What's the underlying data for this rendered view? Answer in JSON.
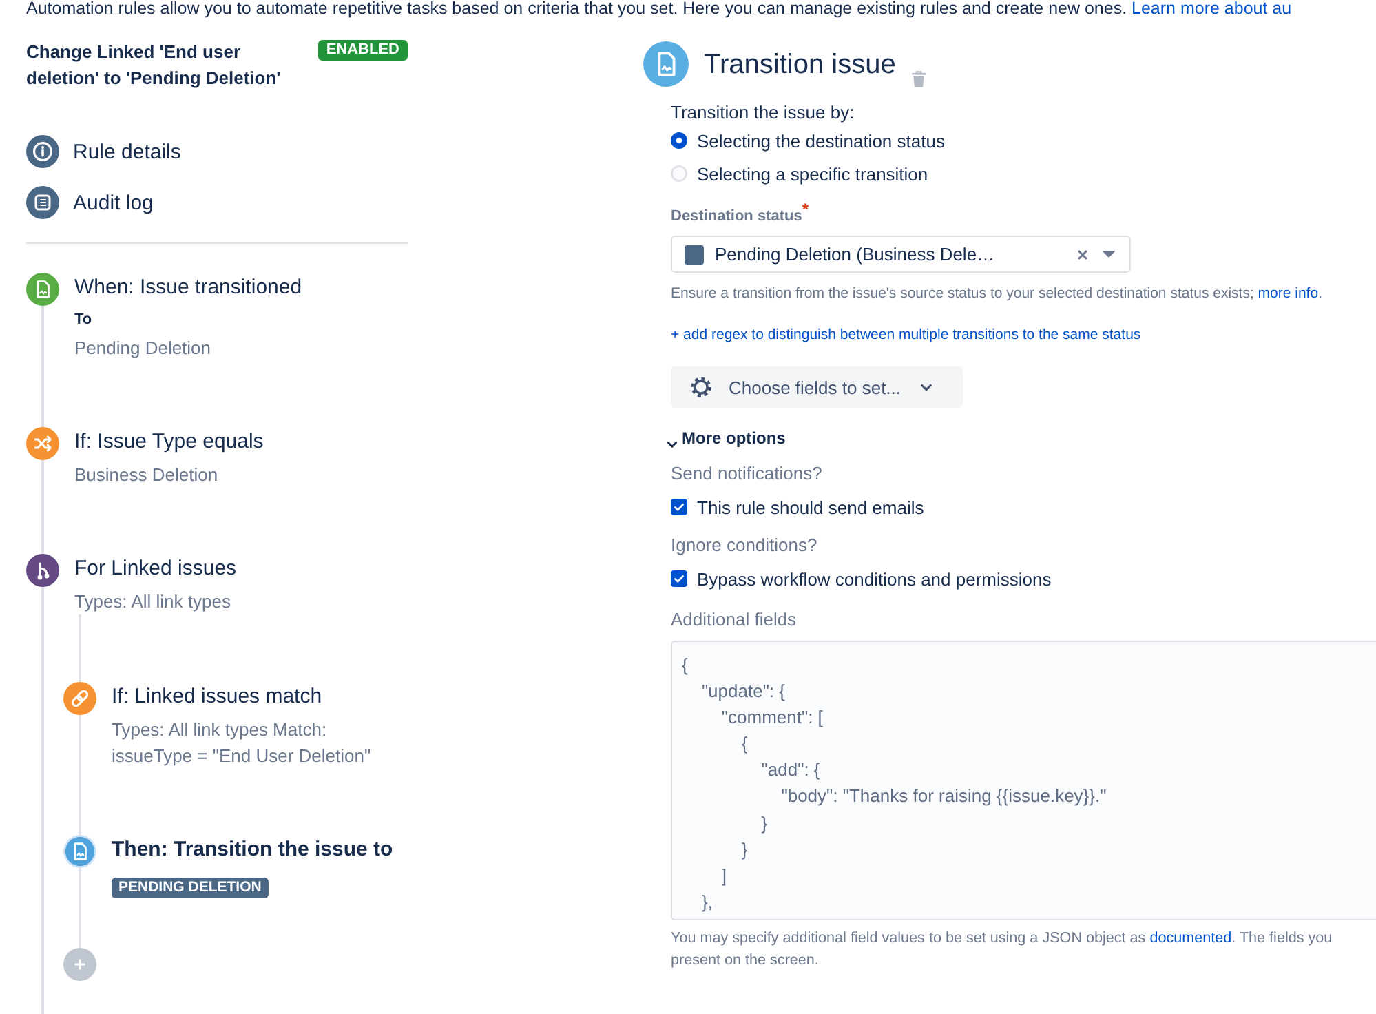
{
  "intro": {
    "text": "Automation rules allow you to automate repetitive tasks based on criteria that you set. Here you can manage existing rules and create new ones. ",
    "link": "Learn more about au"
  },
  "rule": {
    "title": "Change Linked 'End user deletion' to 'Pending Deletion'",
    "status": "ENABLED",
    "enabled": true
  },
  "nav": [
    {
      "kind": "details",
      "label": "Rule details"
    },
    {
      "kind": "log",
      "label": "Audit log"
    }
  ],
  "steps": [
    {
      "kind": "trigger",
      "title": "When: Issue transitioned",
      "field_label": "To",
      "detail": "Pending Deletion",
      "color": "#5aac44",
      "selected": false
    },
    {
      "kind": "condition",
      "title": "If: Issue Type equals",
      "detail": "Business Deletion",
      "color": "#f79232",
      "selected": false
    },
    {
      "kind": "branch",
      "title": "For Linked issues",
      "detail": "Types: All link types",
      "color": "#654982",
      "selected": false,
      "children": [
        {
          "kind": "match",
          "title": "If: Linked issues match",
          "detail": "Types: All link types Match: issueType = \"End User Deletion\"",
          "color": "#f79232",
          "selected": false
        },
        {
          "kind": "action",
          "title": "Then: Transition the issue to",
          "lozenge": "PENDING DELETION",
          "color": "#4fa3dc",
          "selected": true
        }
      ]
    }
  ],
  "editor": {
    "title": "Transition issue",
    "method": {
      "label": "Transition the issue by:",
      "options": [
        {
          "label": "Selecting the destination status",
          "selected": true
        },
        {
          "label": "Selecting a specific transition",
          "selected": false
        }
      ]
    },
    "destination_status": {
      "label": "Destination status",
      "required_mark": "*",
      "value": "Pending Deletion (Business Dele…"
    },
    "help": {
      "text": "Ensure a transition from the issue's source status to your selected destination status exists; ",
      "link": "more info",
      "text_after": "."
    },
    "regex_link": "+ add regex to distinguish between multiple transitions to the same status",
    "fields_button": "Choose fields to set...",
    "more_options": {
      "label": "More options",
      "expanded": true,
      "groups": [
        {
          "label": "Send notifications?",
          "checkbox": {
            "label": "This rule should send emails",
            "checked": true
          }
        },
        {
          "label": "Ignore conditions?",
          "checkbox": {
            "label": "Bypass workflow conditions and permissions",
            "checked": true
          }
        }
      ],
      "additional_fields": {
        "label": "Additional fields",
        "value": "{\n    \"update\": {\n        \"comment\": [\n            {\n                \"add\": {\n                    \"body\": \"Thanks for raising {{issue.key}}.\"\n                }\n            }\n        ]\n    },"
      },
      "note": {
        "text": "You may specify additional field values to be set using a JSON object as ",
        "link": "documented",
        "text_after": ". The fields you",
        "text_line_2": "present on the screen."
      }
    }
  }
}
